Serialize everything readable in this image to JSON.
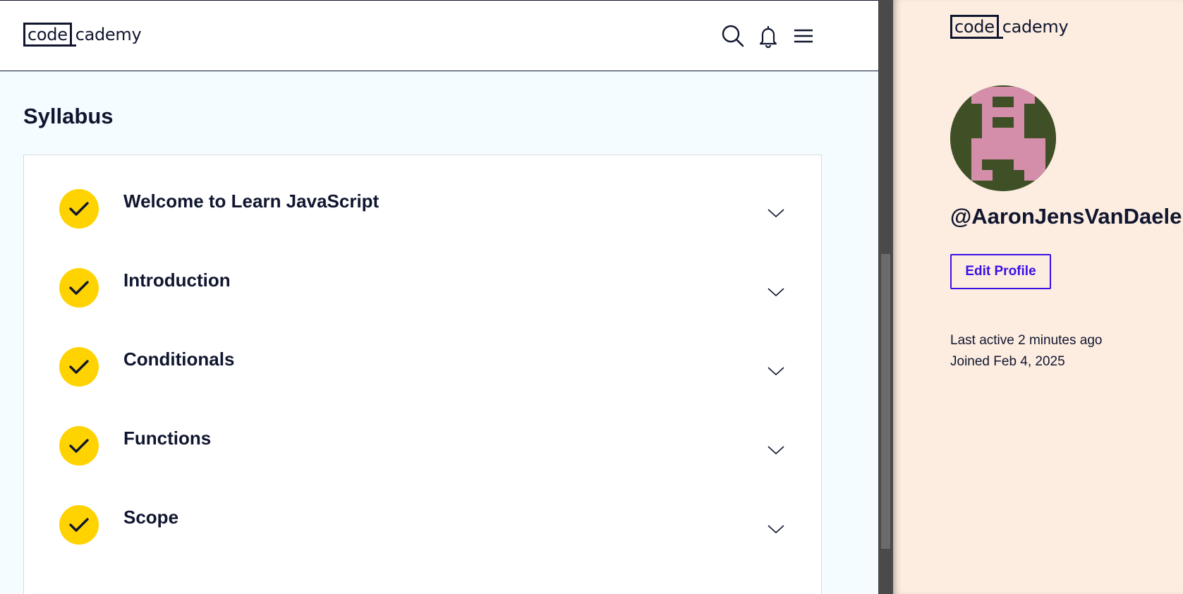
{
  "header": {
    "logo": {
      "boxed": "code",
      "rest": "cademy"
    },
    "icons": [
      "search-icon",
      "bell-icon",
      "menu-icon"
    ]
  },
  "syllabus": {
    "title": "Syllabus",
    "modules": [
      {
        "title": "Welcome to Learn JavaScript",
        "completed": true
      },
      {
        "title": "Introduction",
        "completed": true
      },
      {
        "title": "Conditionals",
        "completed": true
      },
      {
        "title": "Functions",
        "completed": true
      },
      {
        "title": "Scope",
        "completed": true
      }
    ]
  },
  "profile": {
    "logo": {
      "boxed": "code",
      "rest": "cademy"
    },
    "username": "@AaronJensVanDaele",
    "edit_label": "Edit Profile",
    "last_active": "Last active 2 minutes ago",
    "joined": "Joined Feb 4, 2025"
  },
  "colors": {
    "navy": "#10162f",
    "yellow": "#ffd300",
    "accent": "#3a10e5",
    "right_bg": "#fdede1",
    "left_bg": "#f5fcff",
    "avatar_green": "#3f5026",
    "avatar_pink": "#d48eaa"
  }
}
